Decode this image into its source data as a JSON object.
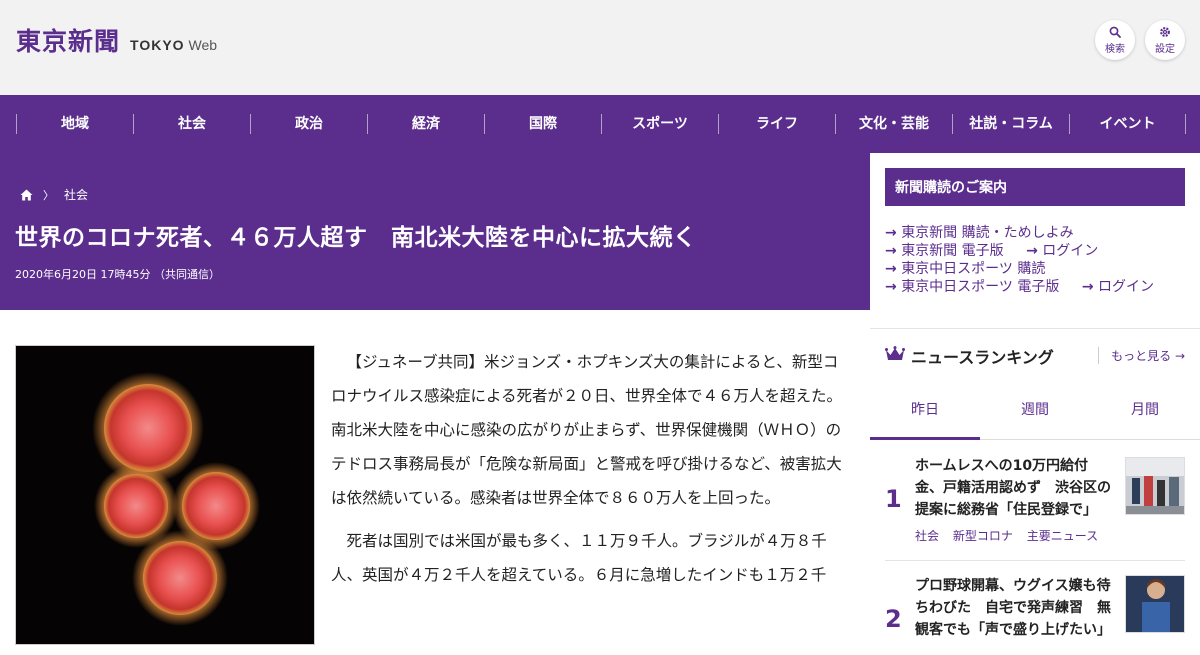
{
  "header": {
    "logo_kanji": "東京新聞",
    "logo_tokyo": "TOKYO",
    "logo_web": "Web",
    "search_label": "検索",
    "settings_label": "設定"
  },
  "nav": [
    "地域",
    "社会",
    "政治",
    "経済",
    "国際",
    "スポーツ",
    "ライフ",
    "文化・芸能",
    "社説・コラム",
    "イベント"
  ],
  "article": {
    "breadcrumb_category": "社会",
    "title": "世界のコロナ死者、４６万人超す　南北米大陸を中心に拡大続く",
    "date": "2020年6月20日 17時45分 （共同通信）",
    "paragraphs": [
      "【ジュネーブ共同】米ジョンズ・ホプキンズ大の集計によると、新型コロナウイルス感染症による死者が２０日、世界全体で４６万人を超えた。南北米大陸を中心に感染の広がりが止まらず、世界保健機関（ＷＨＯ）のテドロス事務局長が「危険な新局面」と警戒を呼び掛けるなど、被害拡大は依然続いている。感染者は世界全体で８６０万人を上回った。",
      "死者は国別では米国が最も多く、１１万９千人。ブラジルが４万８千人、英国が４万２千人を超えている。６月に急増したインドも１万２千"
    ]
  },
  "sidebar": {
    "subscribe_title": "新聞購読のご案内",
    "links": {
      "l1": "東京新聞 購読・ためしよみ",
      "l2": "東京新聞 電子版",
      "l2b": "ログイン",
      "l3": "東京中日スポーツ 購読",
      "l4": "東京中日スポーツ 電子版",
      "l4b": "ログイン"
    },
    "ranking_title": "ニュースランキング",
    "more": "もっと見る",
    "tabs": [
      "昨日",
      "週間",
      "月間"
    ],
    "items": [
      {
        "rank": "1",
        "title": "ホームレスへの10万円給付金、戸籍活用認めず　渋谷区の提案に総務省「住民登録で」",
        "tags": [
          "社会",
          "新型コロナ",
          "主要ニュース"
        ]
      },
      {
        "rank": "2",
        "title": "プロ野球開幕、ウグイス嬢も待ちわびた　自宅で発声練習　無観客でも「声で盛り上げたい」",
        "tags": []
      }
    ]
  },
  "colors": {
    "brand": "#5b2e8e"
  }
}
